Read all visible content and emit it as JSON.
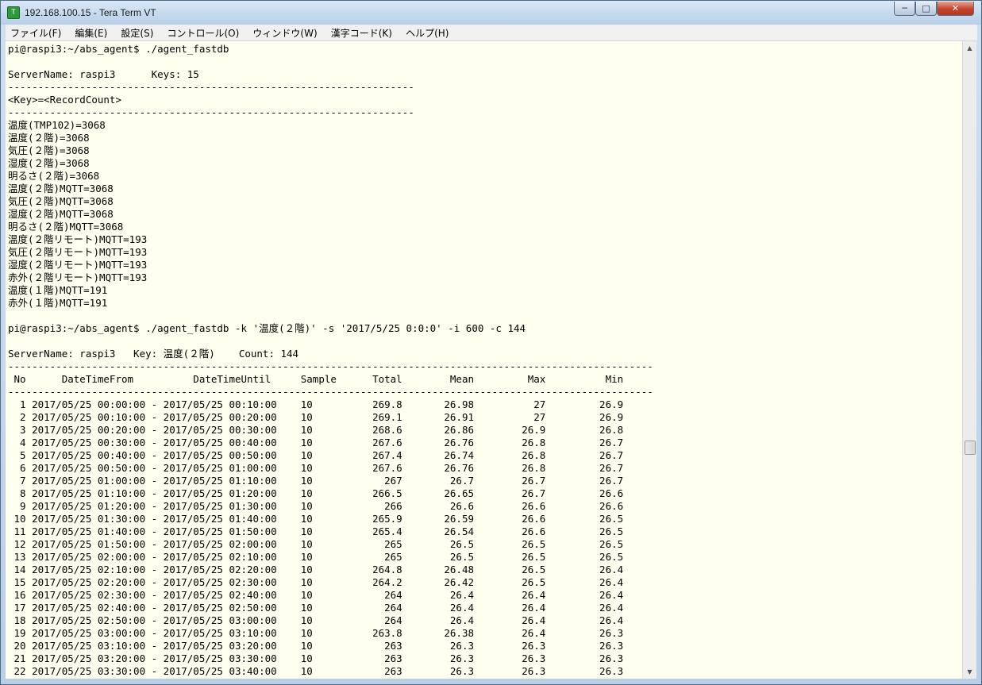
{
  "window": {
    "title": "192.168.100.15 - Tera Term VT",
    "app_icon_glyph": "T",
    "controls": {
      "minimize": "─",
      "maximize": "□",
      "close": "✕"
    }
  },
  "menu": [
    "ファイル(F)",
    "編集(E)",
    "設定(S)",
    "コントロール(O)",
    "ウィンドウ(W)",
    "漢字コード(K)",
    "ヘルプ(H)"
  ],
  "scrollbar": {
    "up_glyph": "▲",
    "down_glyph": "▼"
  },
  "terminal_lines": [
    "pi@raspi3:~/abs_agent$ ./agent_fastdb",
    "",
    "ServerName: raspi3      Keys: 15",
    "--------------------------------------------------------------------",
    "<Key>=<RecordCount>",
    "--------------------------------------------------------------------",
    "温度(TMP102)=3068",
    "温度(２階)=3068",
    "気圧(２階)=3068",
    "湿度(２階)=3068",
    "明るさ(２階)=3068",
    "温度(２階)MQTT=3068",
    "気圧(２階)MQTT=3068",
    "湿度(２階)MQTT=3068",
    "明るさ(２階)MQTT=3068",
    "温度(２階リモート)MQTT=193",
    "気圧(２階リモート)MQTT=193",
    "湿度(２階リモート)MQTT=193",
    "赤外(２階リモート)MQTT=193",
    "温度(１階)MQTT=191",
    "赤外(１階)MQTT=191",
    "",
    "pi@raspi3:~/abs_agent$ ./agent_fastdb -k '温度(２階)' -s '2017/5/25 0:0:0' -i 600 -c 144",
    "",
    "ServerName: raspi3   Key: 温度(２階)    Count: 144",
    "------------------------------------------------------------------------------------------------------------",
    " No      DateTimeFrom          DateTimeUntil     Sample      Total        Mean         Max          Min",
    "------------------------------------------------------------------------------------------------------------",
    "  1 2017/05/25 00:00:00 - 2017/05/25 00:10:00    10          269.8       26.98          27         26.9",
    "  2 2017/05/25 00:10:00 - 2017/05/25 00:20:00    10          269.1       26.91          27         26.9",
    "  3 2017/05/25 00:20:00 - 2017/05/25 00:30:00    10          268.6       26.86        26.9         26.8",
    "  4 2017/05/25 00:30:00 - 2017/05/25 00:40:00    10          267.6       26.76        26.8         26.7",
    "  5 2017/05/25 00:40:00 - 2017/05/25 00:50:00    10          267.4       26.74        26.8         26.7",
    "  6 2017/05/25 00:50:00 - 2017/05/25 01:00:00    10          267.6       26.76        26.8         26.7",
    "  7 2017/05/25 01:00:00 - 2017/05/25 01:10:00    10            267        26.7        26.7         26.7",
    "  8 2017/05/25 01:10:00 - 2017/05/25 01:20:00    10          266.5       26.65        26.7         26.6",
    "  9 2017/05/25 01:20:00 - 2017/05/25 01:30:00    10            266        26.6        26.6         26.6",
    " 10 2017/05/25 01:30:00 - 2017/05/25 01:40:00    10          265.9       26.59        26.6         26.5",
    " 11 2017/05/25 01:40:00 - 2017/05/25 01:50:00    10          265.4       26.54        26.6         26.5",
    " 12 2017/05/25 01:50:00 - 2017/05/25 02:00:00    10            265        26.5        26.5         26.5",
    " 13 2017/05/25 02:00:00 - 2017/05/25 02:10:00    10            265        26.5        26.5         26.5",
    " 14 2017/05/25 02:10:00 - 2017/05/25 02:20:00    10          264.8       26.48        26.5         26.4",
    " 15 2017/05/25 02:20:00 - 2017/05/25 02:30:00    10          264.2       26.42        26.5         26.4",
    " 16 2017/05/25 02:30:00 - 2017/05/25 02:40:00    10            264        26.4        26.4         26.4",
    " 17 2017/05/25 02:40:00 - 2017/05/25 02:50:00    10            264        26.4        26.4         26.4",
    " 18 2017/05/25 02:50:00 - 2017/05/25 03:00:00    10            264        26.4        26.4         26.4",
    " 19 2017/05/25 03:00:00 - 2017/05/25 03:10:00    10          263.8       26.38        26.4         26.3",
    " 20 2017/05/25 03:10:00 - 2017/05/25 03:20:00    10            263        26.3        26.3         26.3",
    " 21 2017/05/25 03:20:00 - 2017/05/25 03:30:00    10            263        26.3        26.3         26.3",
    " 22 2017/05/25 03:30:00 - 2017/05/25 03:40:00    10            263        26.3        26.3         26.3"
  ]
}
